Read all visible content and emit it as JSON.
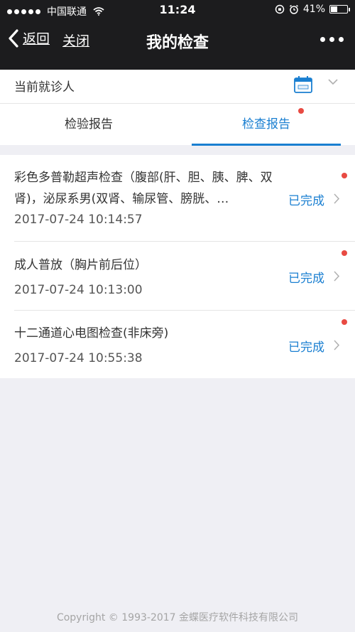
{
  "status_bar": {
    "carrier": "中国联通",
    "time": "11:24",
    "battery": "41%",
    "battery_level": 0.41
  },
  "nav": {
    "back_label": "返回",
    "close_label": "关闭",
    "title": "我的检查"
  },
  "visit": {
    "label": "当前就诊人"
  },
  "tabs": [
    {
      "label": "检验报告"
    },
    {
      "label": "检查报告"
    }
  ],
  "reports": [
    {
      "title": "彩色多普勒超声检查（腹部(肝、胆、胰、脾、双肾)，泌尿系男(双肾、输尿管、膀胱、…",
      "time": "2017-07-24 10:14:57",
      "status": "已完成"
    },
    {
      "title": "成人普放（胸片前后位）",
      "time": "2017-07-24 10:13:00",
      "status": "已完成"
    },
    {
      "title": "十二通道心电图检查(非床旁)",
      "time": "2017-07-24 10:55:38",
      "status": "已完成"
    }
  ],
  "footer": {
    "copyright": "Copyright © 1993-2017 金蝶医疗软件科技有限公司"
  },
  "colors": {
    "accent": "#1a7fd1",
    "unread_dot": "#e84a42",
    "topbar": "#1c1c1e"
  }
}
